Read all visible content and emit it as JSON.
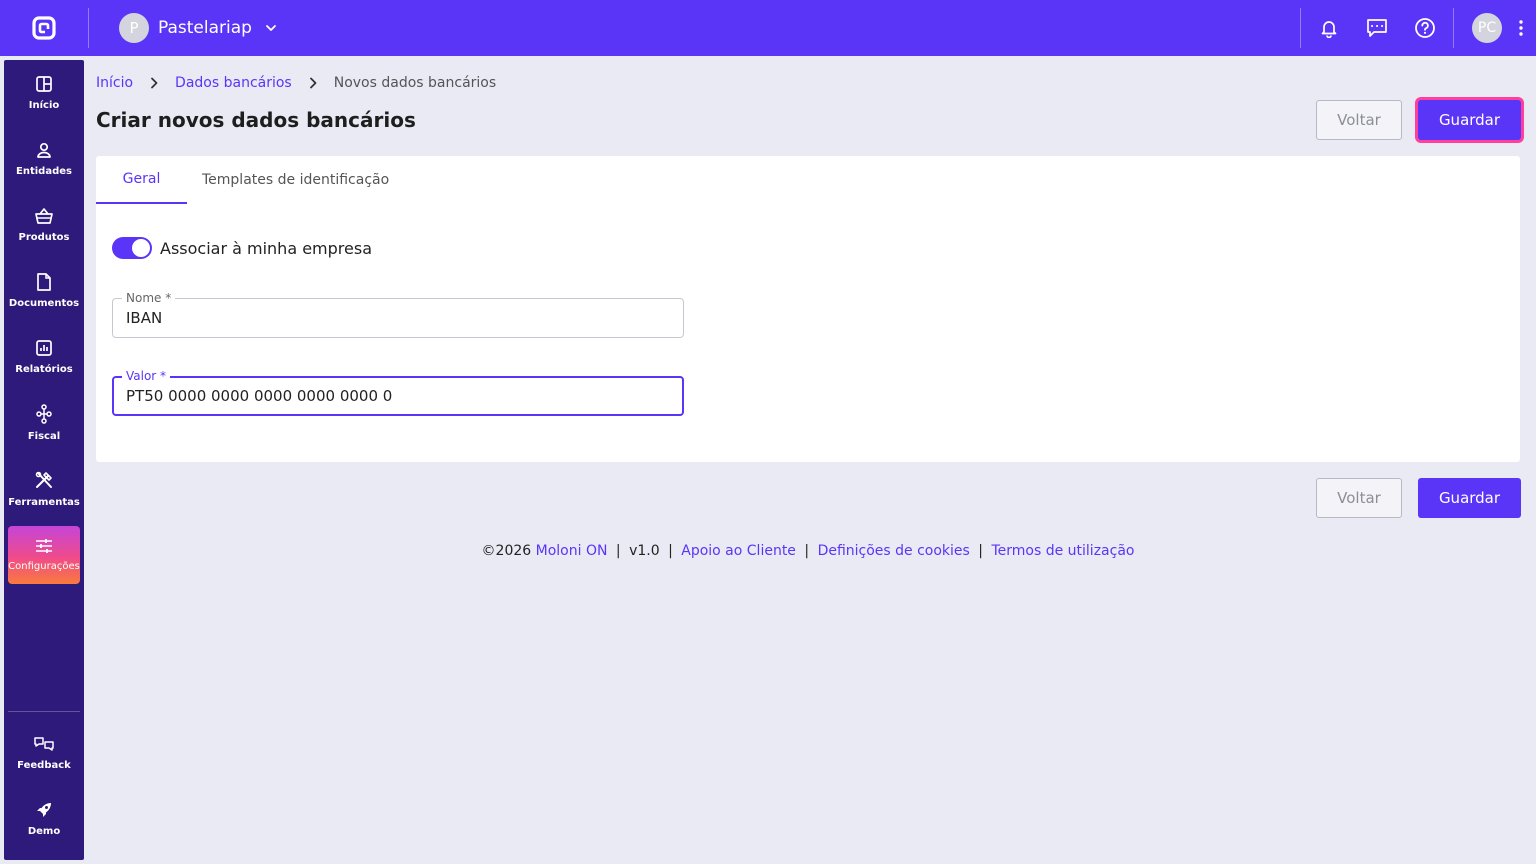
{
  "topbar": {
    "company_initial": "P",
    "company_name": "Pastelariap",
    "user_initials": "PC",
    "bg_color": "#5a35f7"
  },
  "sidebar": {
    "items": [
      {
        "label": "Início",
        "icon": "dashboard-icon"
      },
      {
        "label": "Entidades",
        "icon": "person-icon"
      },
      {
        "label": "Produtos",
        "icon": "basket-icon"
      },
      {
        "label": "Documentos",
        "icon": "document-icon"
      },
      {
        "label": "Relatórios",
        "icon": "chart-icon"
      },
      {
        "label": "Fiscal",
        "icon": "hierarchy-icon"
      },
      {
        "label": "Ferramentas",
        "icon": "tools-icon"
      },
      {
        "label": "Configurações",
        "icon": "sliders-icon",
        "active": true
      }
    ],
    "bottom_items": [
      {
        "label": "Feedback",
        "icon": "feedback-icon"
      },
      {
        "label": "Demo",
        "icon": "rocket-icon"
      }
    ]
  },
  "breadcrumb": {
    "items": [
      "Início",
      "Dados bancários"
    ],
    "current": "Novos dados bancários"
  },
  "page": {
    "title": "Criar novos dados bancários",
    "back_label": "Voltar",
    "save_label": "Guardar"
  },
  "tabs": {
    "geral": "Geral",
    "templates": "Templates de identificação"
  },
  "form": {
    "toggle_label": "Associar à minha empresa",
    "toggle_on": true,
    "nome_label": "Nome *",
    "nome_value": "IBAN",
    "valor_label": "Valor *",
    "valor_value": "PT50 0000 0000 0000 0000 0000 0"
  },
  "footer": {
    "copyright": "©2026",
    "brand": "Moloni ON",
    "version": "v1.0",
    "links": [
      "Apoio ao Cliente",
      "Definições de cookies",
      "Termos de utilização"
    ]
  }
}
